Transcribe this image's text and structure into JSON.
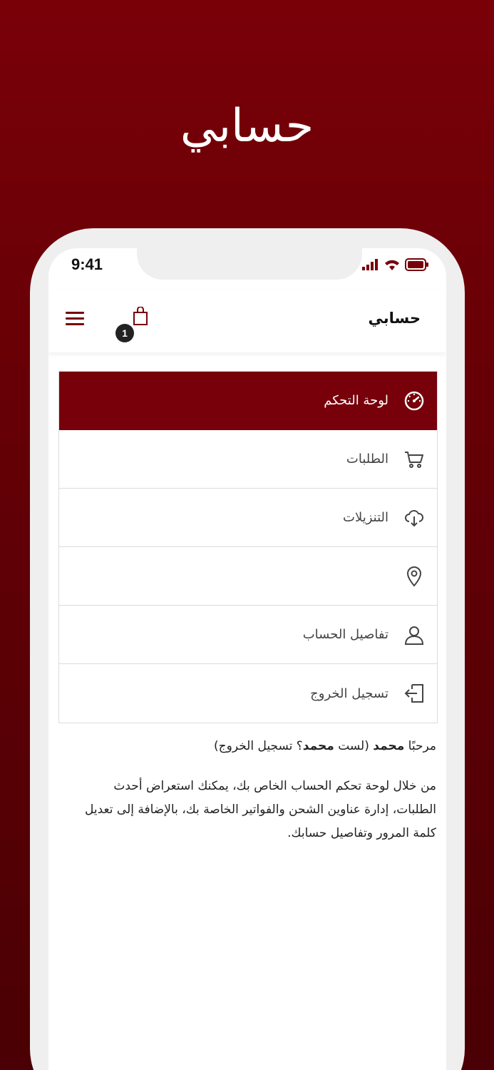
{
  "hero": {
    "title": "حسابي"
  },
  "status_bar": {
    "time": "9:41"
  },
  "header": {
    "title": "حسابي",
    "cart_count": "1"
  },
  "menu": {
    "items": [
      {
        "label": "لوحة التحكم",
        "icon": "dashboard-icon",
        "active": true
      },
      {
        "label": "الطلبات",
        "icon": "cart-icon",
        "active": false
      },
      {
        "label": "التنزيلات",
        "icon": "cloud-download-icon",
        "active": false
      },
      {
        "label": "",
        "icon": "location-pin-icon",
        "active": false
      },
      {
        "label": "تفاصيل الحساب",
        "icon": "user-icon",
        "active": false
      },
      {
        "label": "تسجيل الخروج",
        "icon": "logout-icon",
        "active": false
      }
    ]
  },
  "welcome": {
    "prefix": "مرحبًا ",
    "name": "محمد",
    "middle": " (لست ",
    "name2": "محمد",
    "suffix": "؟ ",
    "logout_link": "تسجيل الخروج",
    "close": ")"
  },
  "description": "من خلال لوحة تحكم الحساب الخاص بك، يمكنك استعراض أحدث الطلبات، إدارة عناوين الشحن والفواتير الخاصة بك، بالإضافة إلى تعديل كلمة المرور وتفاصيل حسابك.",
  "colors": {
    "brand": "#77000a",
    "text": "#444444"
  }
}
